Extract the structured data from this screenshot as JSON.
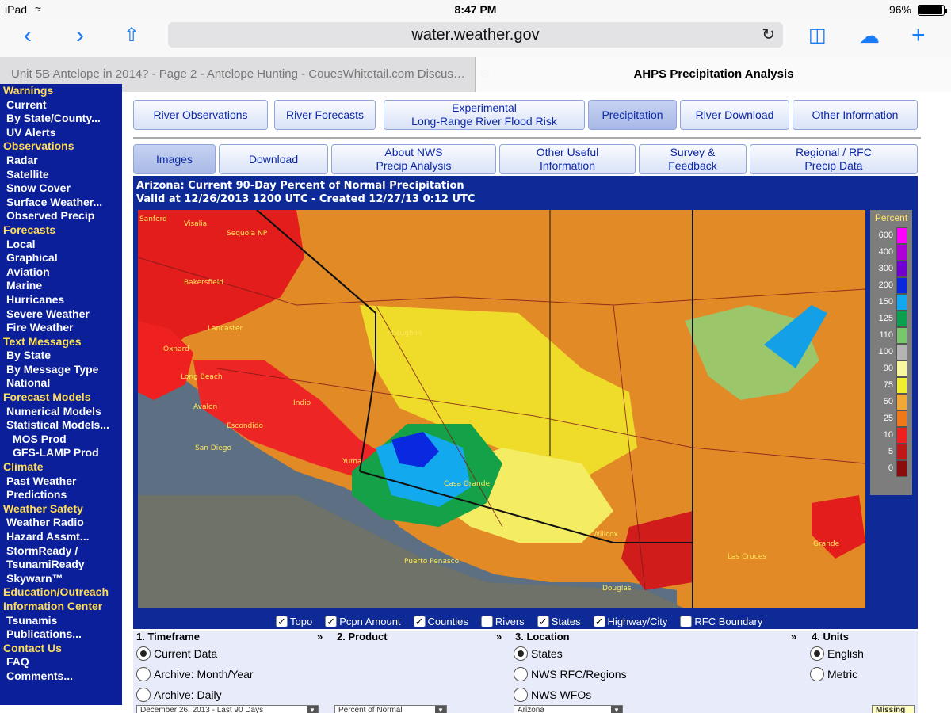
{
  "status": {
    "device": "iPad",
    "time": "8:47 PM",
    "battery": "96%"
  },
  "safari": {
    "url": "water.weather.gov",
    "tabs": [
      {
        "title": "Unit 5B Antelope in 2014? - Page 2 - Antelope Hunting - CouesWhitetail.com Discus…"
      },
      {
        "title": "AHPS Precipitation Analysis"
      }
    ]
  },
  "sidebar": {
    "sections": [
      {
        "kind": "head",
        "label": "Warnings"
      },
      {
        "kind": "item",
        "label": "Current"
      },
      {
        "kind": "item",
        "label": "By State/County..."
      },
      {
        "kind": "item",
        "label": "UV Alerts"
      },
      {
        "kind": "head",
        "label": "Observations"
      },
      {
        "kind": "item",
        "label": "Radar"
      },
      {
        "kind": "item",
        "label": "Satellite"
      },
      {
        "kind": "item",
        "label": "Snow Cover"
      },
      {
        "kind": "item",
        "label": "Surface Weather..."
      },
      {
        "kind": "item",
        "label": "Observed Precip"
      },
      {
        "kind": "head",
        "label": "Forecasts"
      },
      {
        "kind": "item",
        "label": "Local"
      },
      {
        "kind": "item",
        "label": "Graphical"
      },
      {
        "kind": "item",
        "label": "Aviation"
      },
      {
        "kind": "item",
        "label": "Marine"
      },
      {
        "kind": "item",
        "label": "Hurricanes"
      },
      {
        "kind": "item",
        "label": "Severe Weather"
      },
      {
        "kind": "item",
        "label": "Fire Weather"
      },
      {
        "kind": "head",
        "label": "Text Messages"
      },
      {
        "kind": "item",
        "label": "By State"
      },
      {
        "kind": "item",
        "label": "By Message Type"
      },
      {
        "kind": "item",
        "label": "National"
      },
      {
        "kind": "head",
        "label": "Forecast Models"
      },
      {
        "kind": "item",
        "label": "Numerical Models"
      },
      {
        "kind": "item",
        "label": "Statistical Models..."
      },
      {
        "kind": "sub",
        "label": "MOS Prod"
      },
      {
        "kind": "sub",
        "label": "GFS-LAMP Prod"
      },
      {
        "kind": "head",
        "label": "Climate"
      },
      {
        "kind": "item",
        "label": "Past Weather"
      },
      {
        "kind": "item",
        "label": "Predictions"
      },
      {
        "kind": "head",
        "label": "Weather Safety"
      },
      {
        "kind": "item",
        "label": "Weather Radio"
      },
      {
        "kind": "item",
        "label": "Hazard Assmt..."
      },
      {
        "kind": "item",
        "label": "StormReady /"
      },
      {
        "kind": "item",
        "label": "TsunamiReady"
      },
      {
        "kind": "item",
        "label": "Skywarn™"
      },
      {
        "kind": "head",
        "label": "Education/Outreach"
      },
      {
        "kind": "head",
        "label": "Information Center"
      },
      {
        "kind": "item",
        "label": "Tsunamis"
      },
      {
        "kind": "item",
        "label": "Publications..."
      },
      {
        "kind": "head",
        "label": "Contact Us"
      },
      {
        "kind": "item",
        "label": "FAQ"
      },
      {
        "kind": "item",
        "label": "Comments..."
      }
    ]
  },
  "nav_row1": [
    {
      "label": "River Observations"
    },
    {
      "label": "River Forecasts"
    },
    {
      "label": "Experimental\nLong-Range River Flood Risk"
    },
    {
      "label": "Precipitation",
      "active": true
    },
    {
      "label": "River Download"
    },
    {
      "label": "Other Information"
    }
  ],
  "nav_row2": [
    {
      "label": "Images",
      "active": true
    },
    {
      "label": "Download"
    },
    {
      "label": "About NWS\nPrecip Analysis"
    },
    {
      "label": "Other Useful\nInformation"
    },
    {
      "label": "Survey &\nFeedback"
    },
    {
      "label": "Regional / RFC\nPrecip Data"
    }
  ],
  "map": {
    "title_line1": "Arizona: Current 90-Day Percent of Normal Precipitation",
    "title_line2": "Valid at 12/26/2013 1200 UTC - Created 12/27/13 0:12 UTC",
    "places": [
      "Sanford",
      "Visalia",
      "Sequoia NP",
      "Bakersfield",
      "Oxnard",
      "Lancaster",
      "Long Beach",
      "Avalon",
      "Indio",
      "Escondido",
      "San Diego",
      "Yuma",
      "Casa Grande",
      "Puerto Penasco",
      "Douglas",
      "Willcox",
      "Las Cruces",
      "Laughlin",
      "Grande"
    ]
  },
  "legend": {
    "title": "Percent",
    "entries": [
      {
        "label": "600",
        "color": "#ff00ff"
      },
      {
        "label": "400",
        "color": "#b000d8"
      },
      {
        "label": "300",
        "color": "#7000d0"
      },
      {
        "label": "200",
        "color": "#0a28e0"
      },
      {
        "label": "150",
        "color": "#10a8f0"
      },
      {
        "label": "125",
        "color": "#0aa050"
      },
      {
        "label": "110",
        "color": "#76c86a"
      },
      {
        "label": "100",
        "color": "#b4b4b4"
      },
      {
        "label": "90",
        "color": "#f7f7a0"
      },
      {
        "label": "75",
        "color": "#f0ee30"
      },
      {
        "label": "50",
        "color": "#f0a838"
      },
      {
        "label": "25",
        "color": "#f07818"
      },
      {
        "label": "10",
        "color": "#ee2020"
      },
      {
        "label": "5",
        "color": "#c01818"
      },
      {
        "label": "0",
        "color": "#8a0c0c"
      }
    ]
  },
  "overlays": [
    {
      "label": "Topo",
      "checked": true
    },
    {
      "label": "Pcpn Amount",
      "checked": true
    },
    {
      "label": "Counties",
      "checked": true
    },
    {
      "label": "Rivers",
      "checked": false
    },
    {
      "label": "States",
      "checked": true
    },
    {
      "label": "Highway/City",
      "checked": true
    },
    {
      "label": "RFC Boundary",
      "checked": false
    }
  ],
  "controls": {
    "timeframe": {
      "head": "1. Timeframe",
      "options": [
        {
          "label": "Current Data",
          "on": true
        },
        {
          "label": "Archive: Month/Year",
          "on": false
        },
        {
          "label": "Archive: Daily",
          "on": false
        }
      ],
      "select": "December 26, 2013 - Last 90 Days"
    },
    "product": {
      "head": "2. Product",
      "select": "Percent of Normal"
    },
    "location": {
      "head": "3. Location",
      "options": [
        {
          "label": "States",
          "on": true
        },
        {
          "label": "NWS RFC/Regions",
          "on": false
        },
        {
          "label": "NWS WFOs",
          "on": false
        }
      ],
      "select": "Arizona"
    },
    "units": {
      "head": "4. Units",
      "options": [
        {
          "label": "English",
          "on": true
        },
        {
          "label": "Metric",
          "on": false
        }
      ]
    },
    "missing": "Missing"
  }
}
